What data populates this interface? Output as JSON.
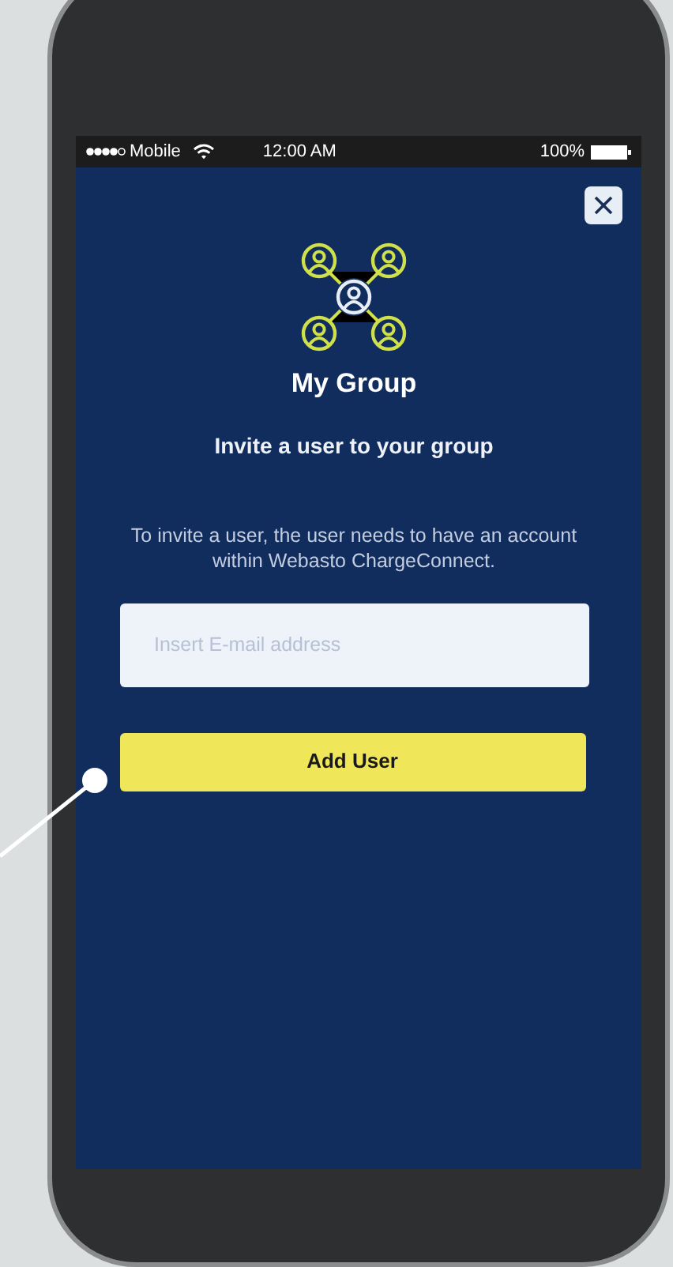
{
  "status_bar": {
    "carrier": "Mobile",
    "time": "12:00 AM",
    "battery": "100%"
  },
  "dialog": {
    "title": "My Group",
    "subtitle": "Invite a user to your group",
    "description": "To invite a user, the user needs to have an account within Webasto ChargeConnect.",
    "email_field": {
      "placeholder": "Insert E-mail address"
    },
    "button": "Add User"
  }
}
